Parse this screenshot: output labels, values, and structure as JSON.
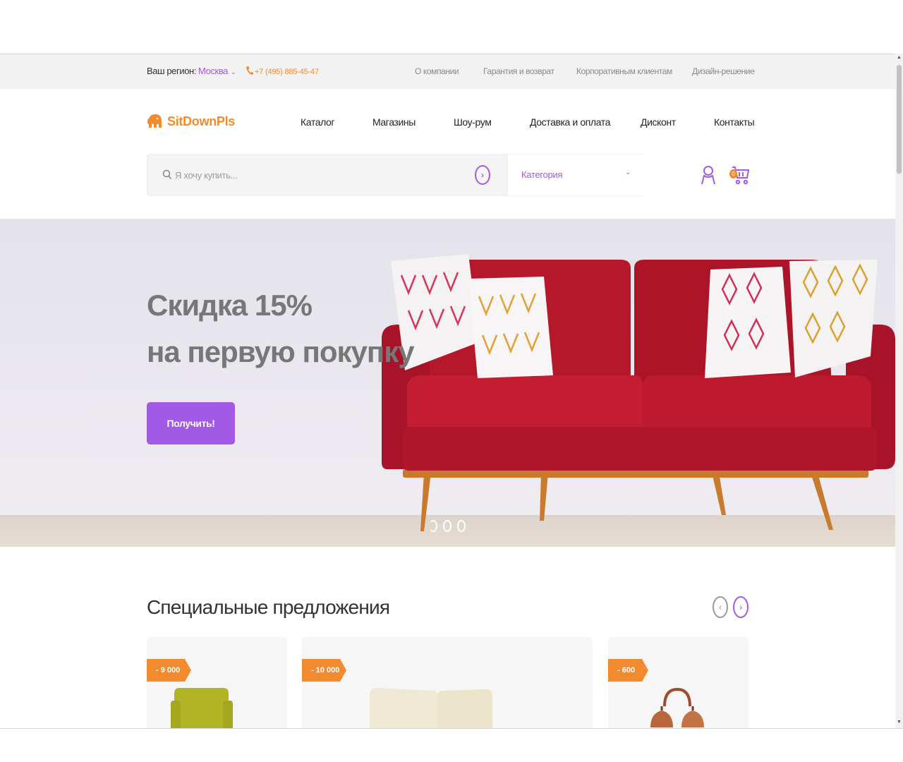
{
  "topbar": {
    "region_label": "Ваш регион:",
    "region_city": "Москва",
    "phone": "+7 (495) 885-45-47",
    "links": [
      "О компании",
      "Гарантия и возврат",
      "Корпоративным клиентам",
      "Дизайн-решение"
    ]
  },
  "header": {
    "logo": "SitDownPls",
    "nav": [
      "Каталог",
      "Магазины",
      "Шоу-рум",
      "Доставка и оплата",
      "Дисконт",
      "Контакты"
    ],
    "search_placeholder": "Я хочу купить...",
    "category_label": "Категория",
    "cart_count": "0"
  },
  "hero": {
    "title_line1": "Скидка 15%",
    "title_line2": "на первую покупку",
    "button_label": "Получить!",
    "slides": 3,
    "active_slide": 1
  },
  "specials": {
    "title": "Специальные предложения",
    "cards": [
      {
        "discount": "- 9 000"
      },
      {
        "discount": "- 10 000"
      },
      {
        "discount": "- 600"
      }
    ]
  },
  "colors": {
    "accent": "#a259e6",
    "orange": "#f28a2e",
    "sofa": "#b5172b"
  }
}
